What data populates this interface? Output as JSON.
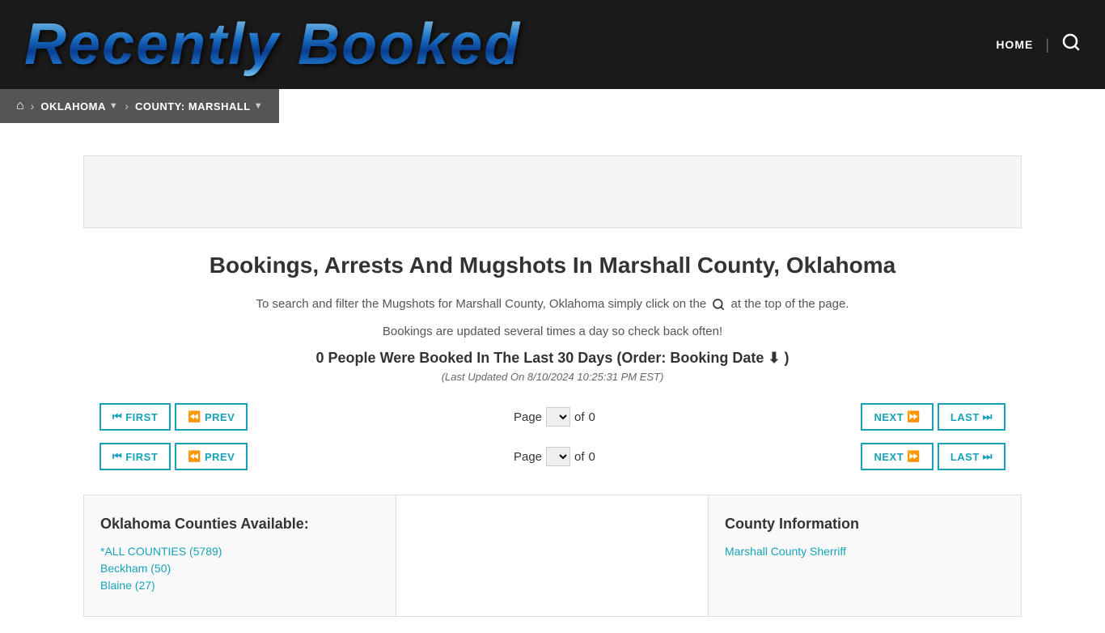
{
  "header": {
    "logo_text": "Recently Booked",
    "nav_home": "HOME",
    "search_aria": "Search"
  },
  "breadcrumb": {
    "home_aria": "Home",
    "state": "OKLAHOMA",
    "county": "COUNTY: MARSHALL"
  },
  "main": {
    "page_title": "Bookings, Arrests And Mugshots In Marshall County, Oklahoma",
    "description_line1": "To search and filter the Mugshots for Marshall County, Oklahoma simply click on the",
    "description_search_icon": "🔍",
    "description_line1_end": "at the top of the page.",
    "description_line2": "Bookings are updated several times a day so check back often!",
    "booking_count_text": "0 People Were Booked In The Last 30 Days (Order: Booking Date",
    "sort_icon": "⬇",
    "booking_count_end": ")",
    "last_updated": "(Last Updated On 8/10/2024 10:25:31 PM EST)"
  },
  "pagination_top": {
    "first_label": "FIRST",
    "prev_label": "PREV",
    "next_label": "NEXT",
    "last_label": "LAST",
    "page_label": "Page",
    "of_label": "of",
    "current_page": "",
    "total_pages": "0"
  },
  "pagination_bottom": {
    "first_label": "FIRST",
    "prev_label": "PREV",
    "next_label": "NEXT",
    "last_label": "LAST",
    "page_label": "Page",
    "of_label": "of",
    "current_page": "",
    "total_pages": "0"
  },
  "counties_section": {
    "title": "Oklahoma Counties Available:",
    "counties": [
      {
        "name": "*ALL COUNTIES (5789)",
        "href": "#"
      },
      {
        "name": "Beckham (50)",
        "href": "#"
      },
      {
        "name": "Blaine (27)",
        "href": "#"
      }
    ]
  },
  "county_info_section": {
    "title": "County Information",
    "link_text": "Marshall County Sherriff",
    "link_href": "#"
  }
}
